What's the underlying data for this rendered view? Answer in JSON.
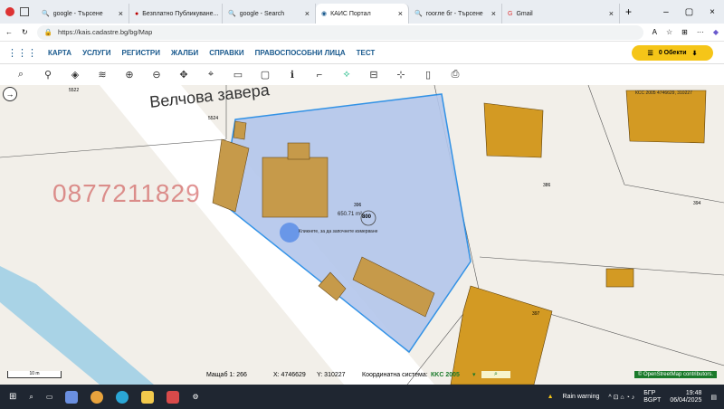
{
  "tabs": [
    {
      "label": "google - Търсене"
    },
    {
      "label": "Безплатно Публикуване..."
    },
    {
      "label": "google - Search"
    },
    {
      "label": "КАИС Портал"
    },
    {
      "label": "гоогле бг - Търсене"
    },
    {
      "label": "Gmail"
    }
  ],
  "address": {
    "url": "https://kais.cadastre.bg/bg/Map"
  },
  "menu": [
    "КАРТА",
    "УСЛУГИ",
    "РЕГИСТРИ",
    "ЖАЛБИ",
    "СПРАВКИ",
    "ПРАВОСПОСОБНИ ЛИЦА",
    "ТЕСТ"
  ],
  "objects_label": "0 Обекти",
  "map": {
    "street_name": "Велчова завера",
    "watermark": "0877211829",
    "area_text": "650.71 m²",
    "click_hint": "Кликнете, за да започнете измерване",
    "coords_tag": "КСС 2005 4746629, 310227",
    "parcel_labels": [
      "5522",
      "5524",
      "396",
      "386",
      "394",
      "397",
      "800"
    ]
  },
  "status": {
    "scale_label": "10 m",
    "mashtab": "Мащаб 1:  266",
    "x": "X:  4746629",
    "y": "Y:  310227",
    "coord_system_label": "Координатна система:",
    "coord_system": "КKC 2005",
    "attribution": "© OpenStreetMap contributors."
  },
  "taskbar": {
    "weather": "Rain warning",
    "lang": "БГР",
    "lang2": "BGPT",
    "time": "19:48",
    "date": "06/04/2025"
  }
}
